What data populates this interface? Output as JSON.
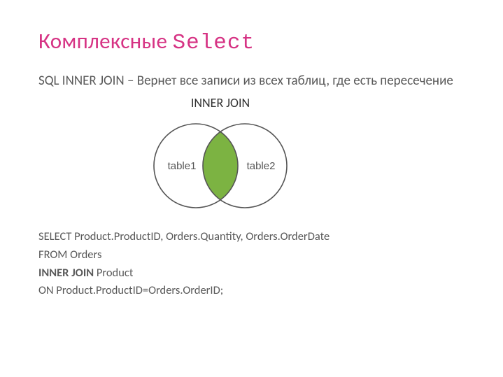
{
  "title": {
    "prefix": "Комплексные ",
    "mono": "Select"
  },
  "description": "SQL INNER JOIN – Вернет все записи из всех таблиц, где есть пересечение",
  "venn": {
    "heading": "INNER JOIN",
    "left_label": "table1",
    "right_label": "table2"
  },
  "sql": {
    "line1": "SELECT Product.ProductID, Orders.Quantity, Orders.OrderDate",
    "line2": "FROM Orders",
    "line3_bold": "INNER JOIN",
    "line3_rest": " Product",
    "line4": "ON Product.ProductID=Orders.OrderID;"
  },
  "chart_data": {
    "type": "diagram",
    "diagram": "venn-2",
    "sets": [
      "table1",
      "table2"
    ],
    "highlight": "intersection",
    "title": "INNER JOIN"
  }
}
